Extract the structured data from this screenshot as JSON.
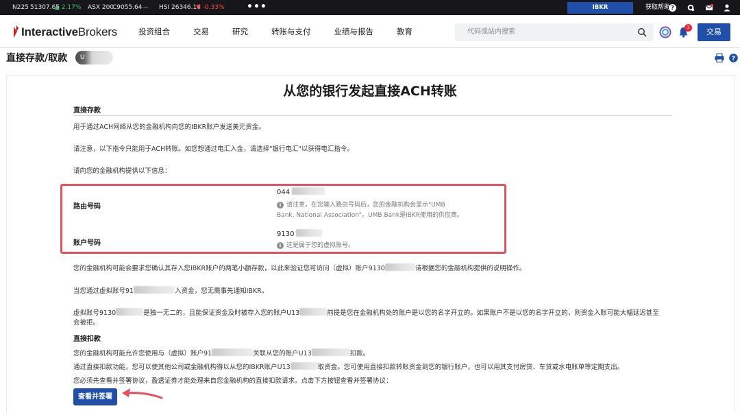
{
  "ticker": {
    "n225_label": "N225",
    "n225_value": "51307.65",
    "n225_change": "▲ 2.17%",
    "asx_label": "ASX 200",
    "asx_value": "C9055.64",
    "asx_change": "—",
    "hsi_label": "HSI",
    "hsi_value": "26346.14",
    "hsi_change": "▼ -0.33%",
    "more": "•••",
    "forecast_button": "IBKR ForecastTrader",
    "help_label": "获取帮助",
    "help_glyph": "?",
    "icons": [
      "gear-icon",
      "mail-icon",
      "user-icon"
    ]
  },
  "header": {
    "logo_bold": "Interactive",
    "logo_light": "Brokers",
    "nav": [
      "投资组合",
      "交易",
      "研究",
      "转账与支付",
      "业绩与报告",
      "教育"
    ],
    "search_placeholder": "代码或站内搜索",
    "notifications_count": "3",
    "trade_button": "交易"
  },
  "page": {
    "title": "直接存款/取款",
    "account_pill": "U"
  },
  "content": {
    "heading": "从您的银行发起直接ACH转账",
    "direct_deposit_title": "直接存款",
    "p1": "用于通过ACH网络从您的金融机构向您的IBKR账户发送美元资金。",
    "p2": "请注意，以下指令只能用于ACH转账。如您想通过电汇入金，请选择\"银行电汇\"以获得电汇指令。",
    "p3": "请向您的金融机构提供以下信息：",
    "routing_label": "路由号码",
    "routing_value": "044",
    "routing_note_1": "请注意，在您输入路由号码后，您的金融机构会显示\"UMB",
    "routing_note_2": "Bank, National Association\"。UMB Bank是IBKR使用的供应商。",
    "account_label": "账户号码",
    "account_value": "9130",
    "account_note": "这是属于您的虚拟账号。",
    "info_glyph": "i",
    "p4a": "您的金融机构可能会要求您确认其存入您IBKR账户的两笔小额存款，以此来验证您可访问（虚拟）账户9130",
    "p4b": "请根据您的金融机构提供的说明操作。",
    "p5a": "当您通过虚拟账号91",
    "p5b": "入资金，您无需事先通知IBKR。",
    "p6a": "虚拟账号9130",
    "p6b": "是独一无二的，且能保证资金及时被存入您的账户U13",
    "p6c": "前提是您在金融机构处的账户是以您的名字开立的。如果账户不是以您的名字开立的，则资金入账可能大幅延迟甚至",
    "p6d": "会被拒。",
    "direct_debit_title": "直接扣款",
    "p7a": "您的金融机构可能允许您使用与（虚拟）账户91",
    "p7b": "关联从您的账户U13",
    "p7c": "扣款。",
    "p8a": "通过直接扣款功能，您可以使其他公司或金融机构得以从您的IBKR账户U13",
    "p8b": "取资金。您可使用直接扣款转账资金到您的银行账户，也可以用其支付房贷、车贷或水电账单等定期支出。",
    "p9": "您必须先查看并签署协议，盈透证券才能处理来自您金融机构的直接扣款请求。点击下方按钮查看并签署协议：",
    "review_button": "查看并签署"
  },
  "colors": {
    "brand_blue": "#1f4fa8",
    "highlight_red": "#e8505b",
    "ticker_bg": "#16161b",
    "up_green": "#3cc76b",
    "down_red": "#ff4a4a"
  }
}
